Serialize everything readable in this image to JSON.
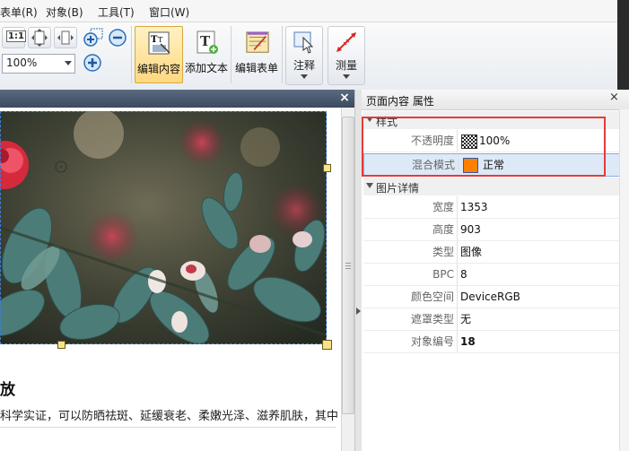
{
  "menu": [
    {
      "label": "表单(R)"
    },
    {
      "label": "对象(B)"
    },
    {
      "label": "工具(T)"
    },
    {
      "label": "窗口(W)"
    }
  ],
  "toolbar": {
    "zoom_value": "100%",
    "actual_size_label": "1:1",
    "buttons": {
      "edit_content": "编辑内容",
      "add_text": "添加文本",
      "edit_form": "编辑表单",
      "annotate": "注释",
      "measure": "测量"
    }
  },
  "document": {
    "heading_partial": "放",
    "body_partial": "科学实证，可以防晒祛斑、延缓衰老、柔嫩光泽、滋养肌肤，其中",
    "close_glyph": "×"
  },
  "panel": {
    "title": "页面内容 属性",
    "close_glyph": "×",
    "categories": {
      "style": "样式",
      "image_details": "图片详情"
    },
    "style_rows": [
      {
        "key": "不透明度",
        "value": "100%"
      },
      {
        "key": "混合模式",
        "value": "正常"
      }
    ],
    "detail_rows": [
      {
        "key": "宽度",
        "value": "1353"
      },
      {
        "key": "高度",
        "value": "903"
      },
      {
        "key": "类型",
        "value": "图像"
      },
      {
        "key": "BPC",
        "value": "8"
      },
      {
        "key": "颜色空间",
        "value": "DeviceRGB"
      },
      {
        "key": "遮罩类型",
        "value": "无"
      },
      {
        "key": "对象编号",
        "value": "18"
      }
    ],
    "colors": {
      "blend_swatch": "#ff7f00",
      "highlight": "#e53a3a",
      "selected_row": "#dde9f7"
    }
  }
}
